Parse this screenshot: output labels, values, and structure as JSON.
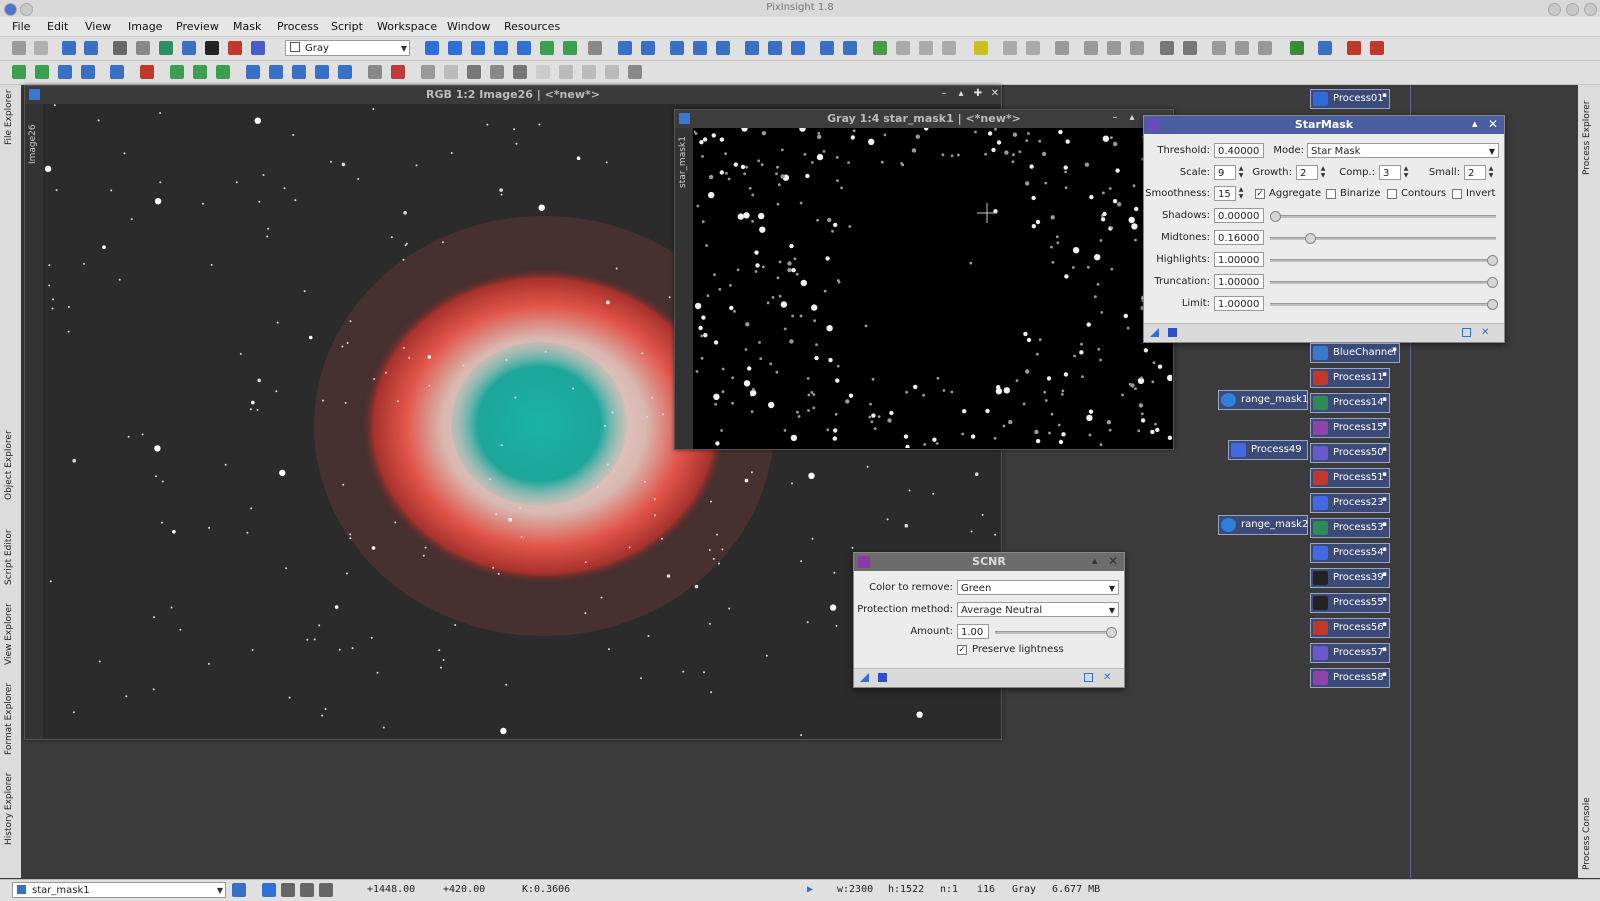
{
  "app": {
    "title": "PixInsight 1.8"
  },
  "menu": [
    "File",
    "Edit",
    "View",
    "Image",
    "Preview",
    "Mask",
    "Process",
    "Script",
    "Workspace",
    "Window",
    "Resources"
  ],
  "toolbar": {
    "channel_combo": "Gray"
  },
  "left_tabs": [
    "File Explorer",
    "Object Explorer",
    "Script Editor",
    "View Explorer",
    "Format Explorer",
    "History Explorer"
  ],
  "right_tabs": [
    "Process Explorer",
    "Process Console"
  ],
  "main_image": {
    "title": "RGB 1:2 Image26 | <*new*>",
    "side_label": "Image26"
  },
  "mask_window": {
    "title": "Gray 1:4 star_mask1 | <*new*>",
    "side_label": "star_mask1"
  },
  "starmask": {
    "title": "StarMask",
    "threshold_label": "Threshold:",
    "threshold": "0.40000",
    "mode_label": "Mode:",
    "mode": "Star Mask",
    "scale_label": "Scale:",
    "scale": "9",
    "growth_label": "Growth:",
    "growth": "2",
    "comp_label": "Comp.:",
    "comp": "3",
    "small_label": "Small:",
    "small": "2",
    "smoothness_label": "Smoothness:",
    "smoothness": "15",
    "aggregate_label": "Aggregate",
    "aggregate": true,
    "binarize_label": "Binarize",
    "binarize": false,
    "contours_label": "Contours",
    "contours": false,
    "invert_label": "Invert",
    "invert": false,
    "shadows_label": "Shadows:",
    "shadows": "0.00000",
    "shadows_level": 0.0,
    "midtones_label": "Midtones:",
    "midtones": "0.16000",
    "midtones_level": 0.16,
    "highlights_label": "Highlights:",
    "highlights": "1.00000",
    "highlights_level": 1.0,
    "truncation_label": "Truncation:",
    "truncation": "1.00000",
    "truncation_level": 1.0,
    "limit_label": "Limit:",
    "limit": "1.00000",
    "limit_level": 1.0
  },
  "scnr": {
    "title": "SCNR",
    "color_label": "Color to remove:",
    "color": "Green",
    "protection_label": "Protection method:",
    "protection": "Average Neutral",
    "amount_label": "Amount:",
    "amount": "1.00",
    "amount_level": 1.0,
    "preserve_label": "Preserve lightness",
    "preserve": true
  },
  "process_icons": [
    {
      "label": "Process01",
      "color": "#2f6bd8"
    },
    {
      "label": "BlueChannel",
      "color": "#3a78d0"
    },
    {
      "label": "Process11",
      "color": "#c0392b"
    },
    {
      "label": "Process14",
      "color": "#2e8b57"
    },
    {
      "label": "Process15",
      "color": "#8e44ad"
    },
    {
      "label": "Process50",
      "color": "#6a5acd"
    },
    {
      "label": "Process51",
      "color": "#c0392b"
    },
    {
      "label": "Process23",
      "color": "#4169e1"
    },
    {
      "label": "Process53",
      "color": "#2e8b57"
    },
    {
      "label": "Process54",
      "color": "#4169e1"
    },
    {
      "label": "Process39",
      "color": "#222222"
    },
    {
      "label": "Process55",
      "color": "#222222"
    },
    {
      "label": "Process56",
      "color": "#c0392b"
    },
    {
      "label": "Process57",
      "color": "#6a5acd"
    },
    {
      "label": "Process58",
      "color": "#8e44ad"
    }
  ],
  "left_icons": [
    {
      "label": "range_mask1",
      "color": "#2f80d8"
    },
    {
      "label": "Process49",
      "color": "#4169e1"
    },
    {
      "label": "range_mask2",
      "color": "#2f80d8"
    }
  ],
  "status": {
    "view": "star_mask1",
    "x": "+1448.00",
    "y": "+420.00",
    "k": "K:0.3606",
    "w": "w:2300",
    "h": "h:1522",
    "n": "n:1",
    "depth": "i16",
    "space": "Gray",
    "size": "6.677 MB"
  }
}
